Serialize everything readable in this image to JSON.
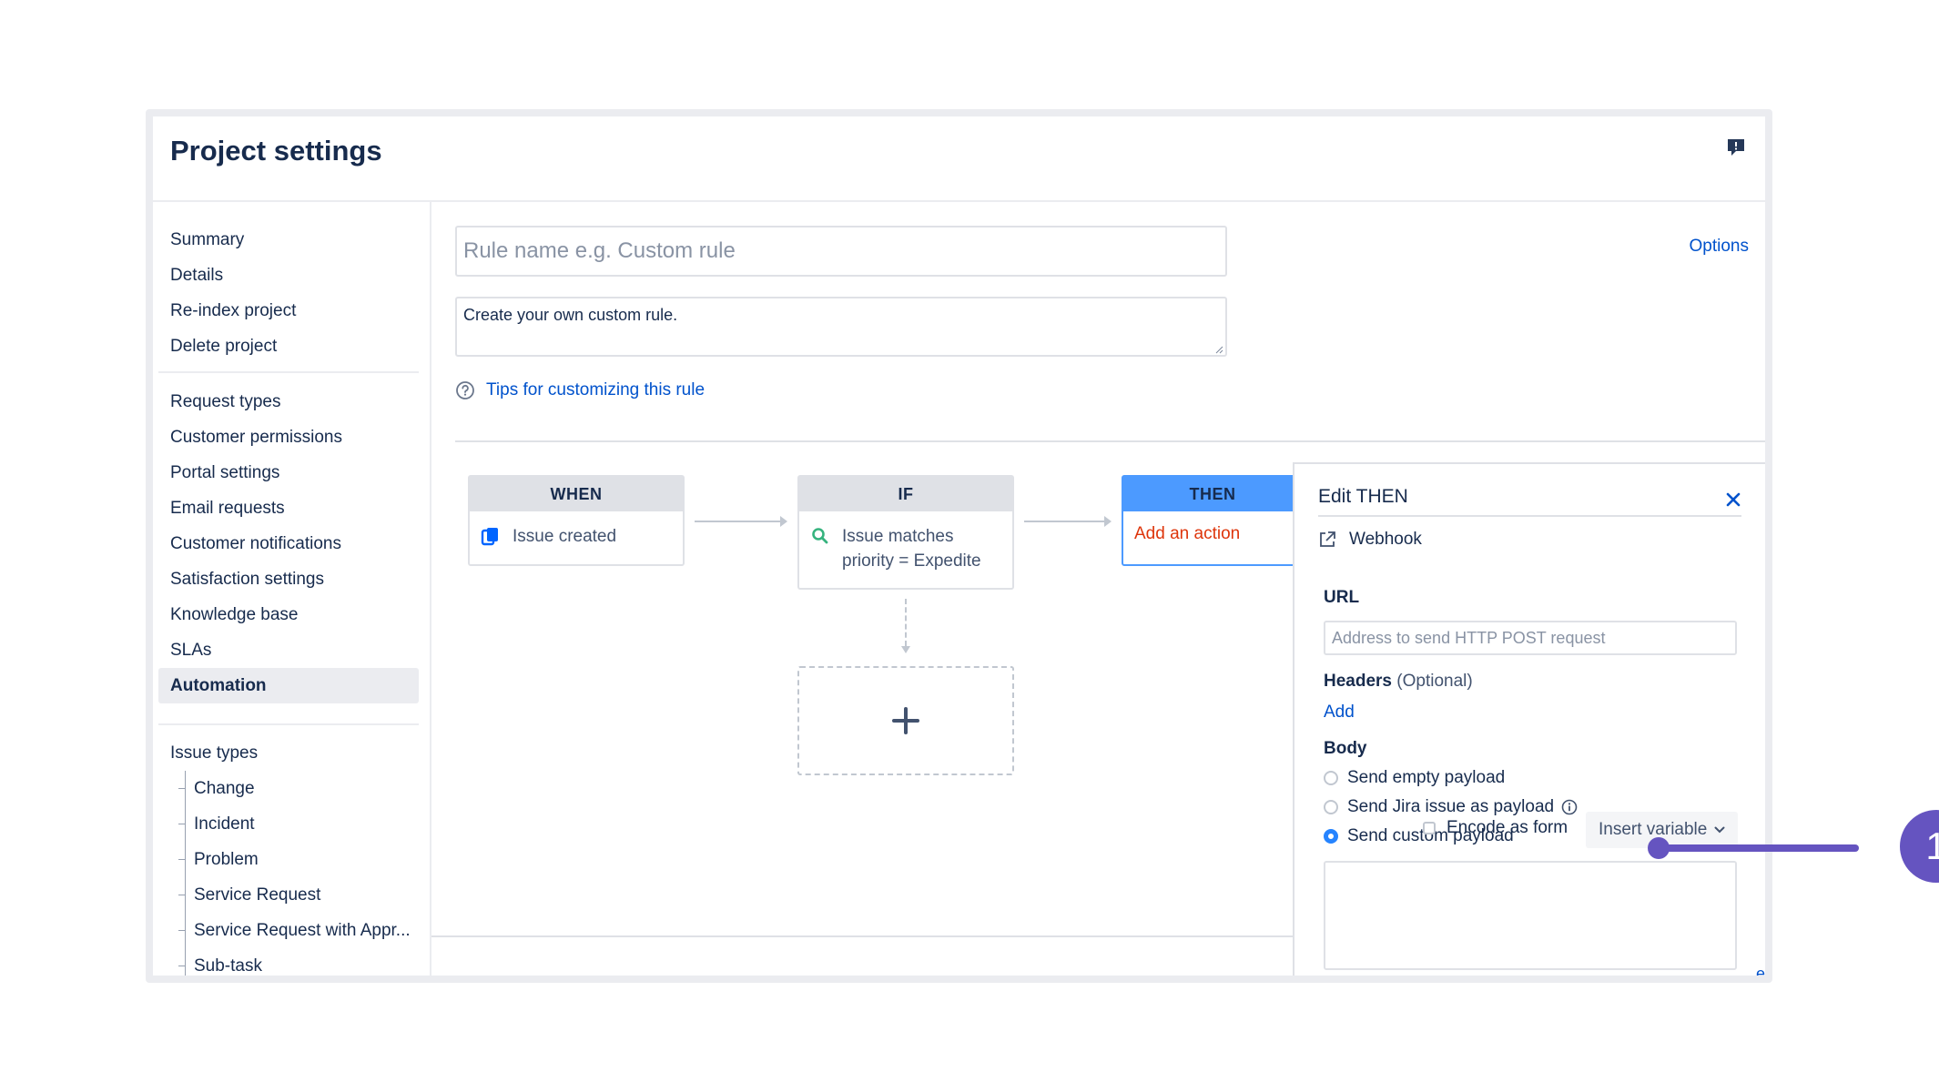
{
  "header": {
    "title": "Project settings"
  },
  "sidebar": {
    "group1": [
      "Summary",
      "Details",
      "Re-index project",
      "Delete project"
    ],
    "group2": [
      "Request types",
      "Customer permissions",
      "Portal settings",
      "Email requests",
      "Customer notifications",
      "Satisfaction settings",
      "Knowledge base",
      "SLAs",
      "Automation"
    ],
    "selected": "Automation",
    "issue_types_label": "Issue types",
    "issue_types": [
      "Change",
      "Incident",
      "Problem",
      "Service Request",
      "Service Request with Appr...",
      "Sub-task"
    ]
  },
  "rule": {
    "name_placeholder": "Rule name e.g. Custom rule",
    "description": "Create your own custom rule.",
    "tips_link": "Tips for customizing this rule",
    "options_link": "Options"
  },
  "flow": {
    "when": {
      "label": "WHEN",
      "text": "Issue created",
      "icon": "copy-icon"
    },
    "if": {
      "label": "IF",
      "text_line1": "Issue matches",
      "text_line2": "priority = Expedite",
      "icon": "search-icon"
    },
    "then": {
      "label": "THEN",
      "text": "Add an action"
    }
  },
  "panel": {
    "title": "Edit THEN",
    "action": "Webhook",
    "url_label": "URL",
    "url_placeholder": "Address to send HTTP POST request",
    "headers_label": "Headers",
    "headers_optional": "(Optional)",
    "headers_add": "Add",
    "body_label": "Body",
    "body_options": [
      "Send empty payload",
      "Send Jira issue as payload",
      "Send custom payload"
    ],
    "body_selected": "Send custom payload",
    "encode_label": "Encode as form",
    "insert_variable": "Insert variable"
  },
  "callout": {
    "number": "1"
  },
  "colors": {
    "accent": "#0052cc",
    "then_blue": "#4c9aff",
    "callout": "#6554c0",
    "action_red": "#de350b"
  }
}
